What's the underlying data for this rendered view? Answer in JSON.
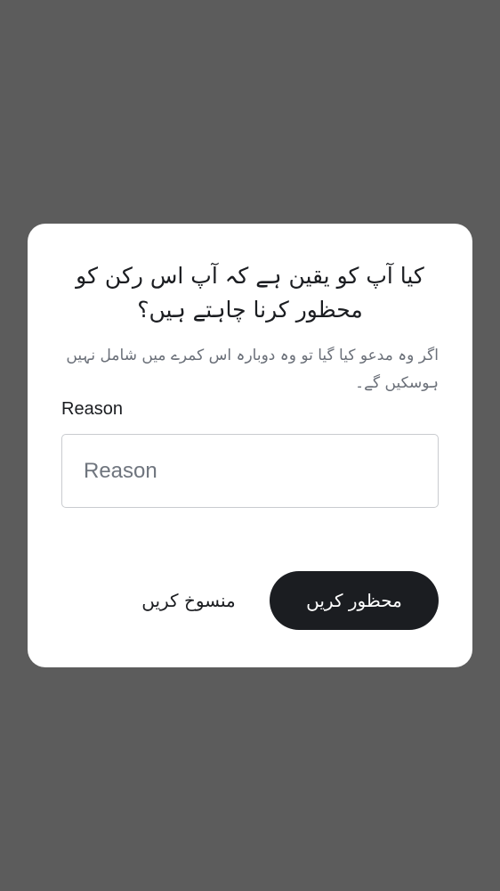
{
  "dialog": {
    "title": "کیا آپ کو یقین ہے کہ آپ اس رکن کو محظور کرنا چاہتے ہیں؟",
    "description": "اگر وہ مدعو کیا گیا تو وہ دوبارہ اس کمرے میں شامل نہیں ہوسکیں گے۔",
    "reason_label": "Reason",
    "reason_placeholder": "Reason",
    "reason_value": "",
    "cancel_label": "منسوخ کریں",
    "confirm_label": "محظور کریں"
  },
  "colors": {
    "overlay": "#5c5c5c",
    "dialog_bg": "#ffffff",
    "primary_button": "#1b1d21",
    "secondary_text": "#6b7079"
  }
}
